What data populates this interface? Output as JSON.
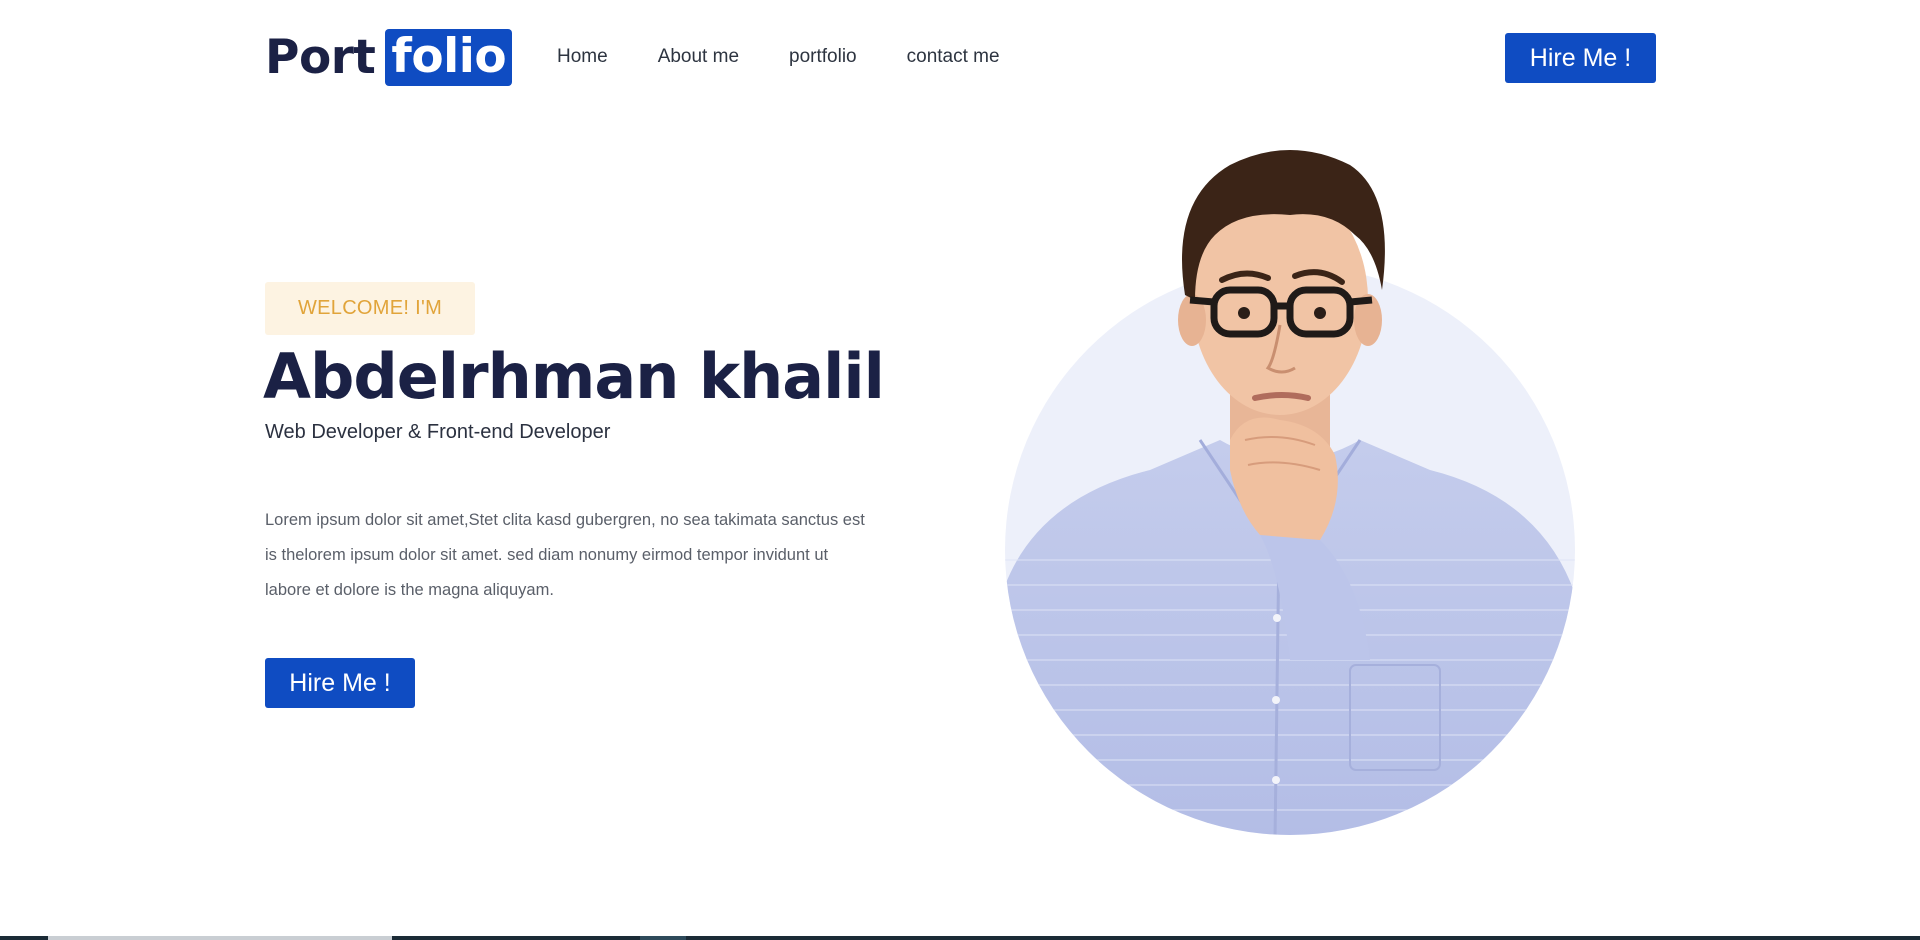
{
  "header": {
    "logo": {
      "part1": "Port",
      "part2": "folio"
    },
    "nav": [
      {
        "label": "Home"
      },
      {
        "label": "About me"
      },
      {
        "label": "portfolio"
      },
      {
        "label": "contact me"
      }
    ],
    "hire_label": "Hire Me !"
  },
  "hero": {
    "welcome": "WELCOME! I'M",
    "name": "Abdelrhman khalil",
    "role": "Web Developer & Front-end Developer",
    "description": "Lorem ipsum dolor sit amet,Stet clita kasd gubergren, no sea takimata sanctus est is thelorem ipsum dolor sit amet. sed diam nonumy eirmod tempor invidunt ut labore et dolore is the magna aliquyam.",
    "hire_label": "Hire Me !"
  },
  "colors": {
    "accent": "#0f4cc2",
    "heading": "#1b2145",
    "badge_bg": "#fdf3e2",
    "badge_text": "#e1a43a",
    "portrait_circle": "#edf0fa"
  }
}
